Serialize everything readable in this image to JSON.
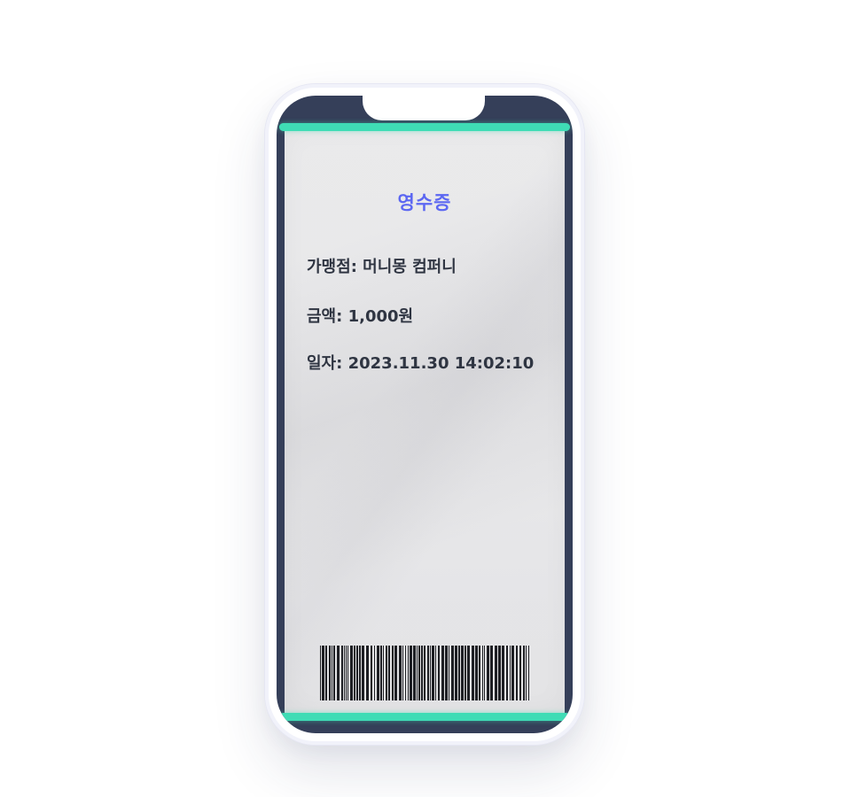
{
  "receipt": {
    "title": "영수증",
    "store_label": "가맹점",
    "store_value": "머니몽 컴퍼니",
    "amount_label": "금액",
    "amount_value": "1,000원",
    "date_label": "일자",
    "date_value": "2023.11.30 14:02:10"
  },
  "colors": {
    "scan_line": "#3fdcb5",
    "title_accent": "#5c67f2",
    "phone_frame": "#353f59",
    "text": "#2f3542"
  },
  "icons": {
    "barcode": "barcode-icon"
  }
}
